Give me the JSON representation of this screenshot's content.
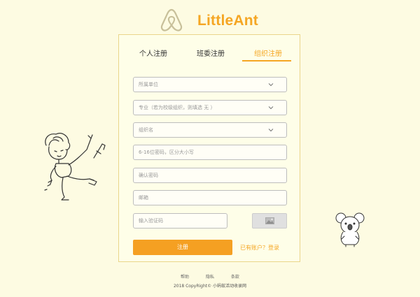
{
  "brand": {
    "name": "LittleAnt",
    "logo_icon": "airbnb-style-logo-icon"
  },
  "tabs": [
    {
      "label": "个人注册",
      "active": false
    },
    {
      "label": "班委注册",
      "active": false
    },
    {
      "label": "组织注册",
      "active": true
    }
  ],
  "form": {
    "unit_select": {
      "placeholder": "所属单位"
    },
    "major_select": {
      "placeholder": "专业（若为校级组织，则填选 无 ）"
    },
    "org_select": {
      "placeholder": "组织名"
    },
    "password": {
      "placeholder": "6-16位密码，区分大小写"
    },
    "confirm_password": {
      "placeholder": "确认密码"
    },
    "email": {
      "placeholder": "邮箱"
    },
    "captcha": {
      "placeholder": "输入验证码",
      "image_icon": "image-icon"
    },
    "submit_label": "注册",
    "login_link": "已有账户？登录"
  },
  "footer": {
    "links": [
      "帮助",
      "隐私",
      "条款"
    ],
    "copyright": "2018 CopyRight© 小蚂蚁活动收录网"
  },
  "colors": {
    "accent": "#f5a623",
    "button": "#f5a022",
    "background": "#fdfbe2"
  }
}
